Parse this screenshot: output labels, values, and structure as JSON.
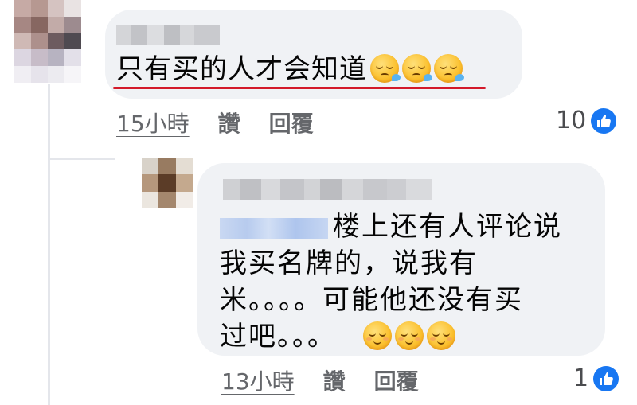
{
  "comments": [
    {
      "text": "只有买的人才会知道",
      "emojis": [
        "sleepy-face",
        "sleepy-face",
        "sleepy-face"
      ],
      "time": "15小時",
      "like_label": "讚",
      "reply_label": "回覆",
      "reaction_count": "10"
    },
    {
      "lines": [
        "楼上还有人评论说",
        "我买名牌的，说我有",
        "米。。。。可能他还没有买",
        "过吧。。。"
      ],
      "emojis": [
        "relieved-face",
        "relieved-face",
        "relieved-face"
      ],
      "time": "13小時",
      "like_label": "讚",
      "reply_label": "回覆",
      "reaction_count": "1"
    }
  ],
  "colors": {
    "bubble": "#f0f2f5",
    "underline": "#d3192a",
    "like_badge": "#1877f2",
    "meta_text": "#65676b"
  },
  "icons": {
    "reaction": "thumbs-up-icon"
  }
}
